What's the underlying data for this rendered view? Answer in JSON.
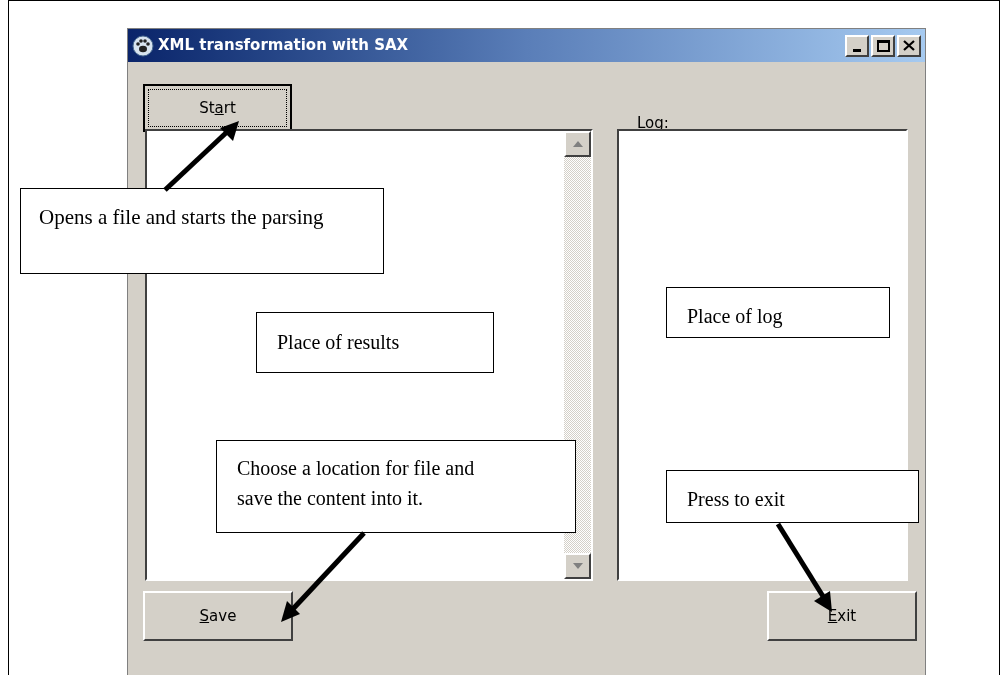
{
  "window": {
    "title": "XML transformation with SAX"
  },
  "buttons": {
    "start": {
      "before": "St",
      "access_key": "a",
      "after": "rt"
    },
    "save": {
      "access_key": "S",
      "after": "ave"
    },
    "exit": {
      "access_key": "E",
      "after": "xit"
    }
  },
  "log_label": "Log:",
  "callouts": [
    {
      "text": "Opens a file and starts the parsing"
    },
    {
      "text": "Place of results"
    },
    {
      "text": "Place of log"
    },
    {
      "text": "Choose a location for file and save the content into it."
    },
    {
      "text": "Press to exit"
    }
  ]
}
